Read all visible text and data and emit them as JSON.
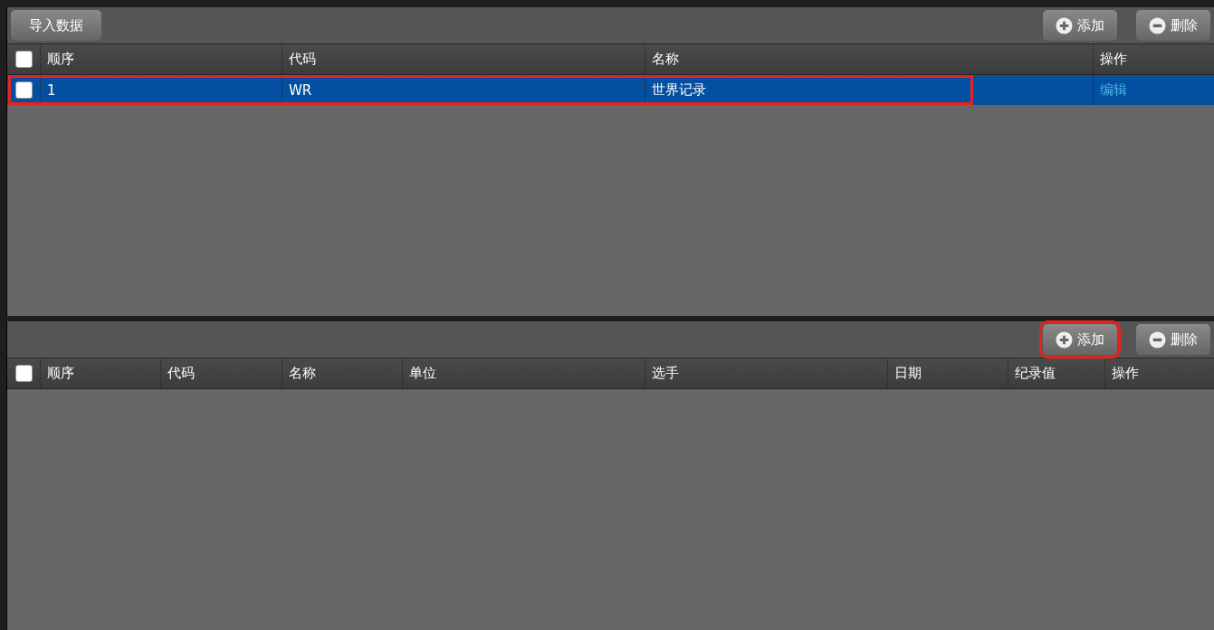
{
  "panels": [
    {
      "toolbar_left": [
        {
          "label": "导入数据",
          "kind": "import",
          "highlighted": false
        }
      ],
      "toolbar_right": [
        {
          "label": "添加",
          "kind": "add",
          "highlighted": false
        },
        {
          "label": "删除",
          "kind": "delete",
          "highlighted": false
        }
      ],
      "table": {
        "select_all_checked": false,
        "columns": [
          "顺序",
          "代码",
          "名称",
          "操作"
        ],
        "rows": [
          {
            "checked": false,
            "selected": true,
            "highlighted": true,
            "cells": [
              "1",
              "WR",
              "世界记录"
            ],
            "action": "编辑"
          }
        ]
      }
    },
    {
      "toolbar_right": [
        {
          "label": "添加",
          "kind": "add",
          "highlighted": true
        },
        {
          "label": "删除",
          "kind": "delete",
          "highlighted": false
        }
      ],
      "table": {
        "select_all_checked": false,
        "columns": [
          "顺序",
          "代码",
          "名称",
          "单位",
          "选手",
          "日期",
          "纪录值",
          "操作"
        ]
      }
    }
  ]
}
